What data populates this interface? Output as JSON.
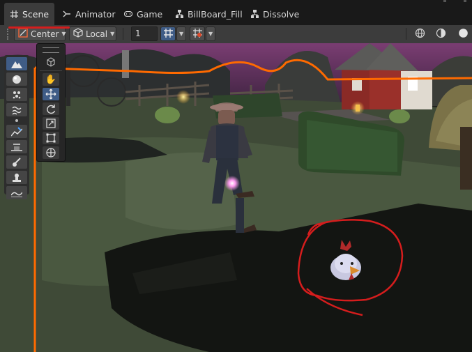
{
  "tabs": [
    {
      "label": "Scene",
      "icon": "grid-icon",
      "active": true
    },
    {
      "label": "Animator",
      "icon": "animator-icon",
      "active": false
    },
    {
      "label": "Game",
      "icon": "gamepad-icon",
      "active": false
    },
    {
      "label": "BillBoard_Fill",
      "icon": "shader-graph-icon",
      "active": false
    },
    {
      "label": "Dissolve",
      "icon": "shader-graph-icon",
      "active": false
    }
  ],
  "toolbar": {
    "pivot_label": "Center",
    "space_label": "Local",
    "grid_snap_value": "1"
  },
  "colors": {
    "selection_blue": "#3f5c86",
    "annotation_red": "#d51d1d",
    "gizmo_orange": "#ff6a00"
  }
}
